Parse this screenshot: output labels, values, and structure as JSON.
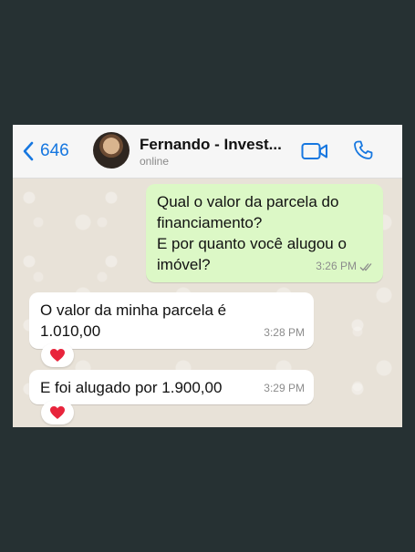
{
  "header": {
    "back_count": "646",
    "contact_name": "Fernando - Invest...",
    "status": "online"
  },
  "messages": [
    {
      "direction": "outgoing",
      "text": "Qual o valor da parcela do financiamento?\nE por quanto você alugou o imóvel?",
      "time": "3:26 PM",
      "read_receipt": "double-check-icon"
    },
    {
      "direction": "incoming",
      "text": "O valor da minha parcela é 1.010,00",
      "time": "3:28 PM",
      "reaction": "❤️"
    },
    {
      "direction": "incoming",
      "text": "E foi alugado por 1.900,00",
      "time": "3:29 PM",
      "reaction": "❤️"
    }
  ],
  "colors": {
    "accent": "#1677e0",
    "outgoing_bubble": "#dcf8c6",
    "incoming_bubble": "#ffffff",
    "background": "#263133"
  }
}
